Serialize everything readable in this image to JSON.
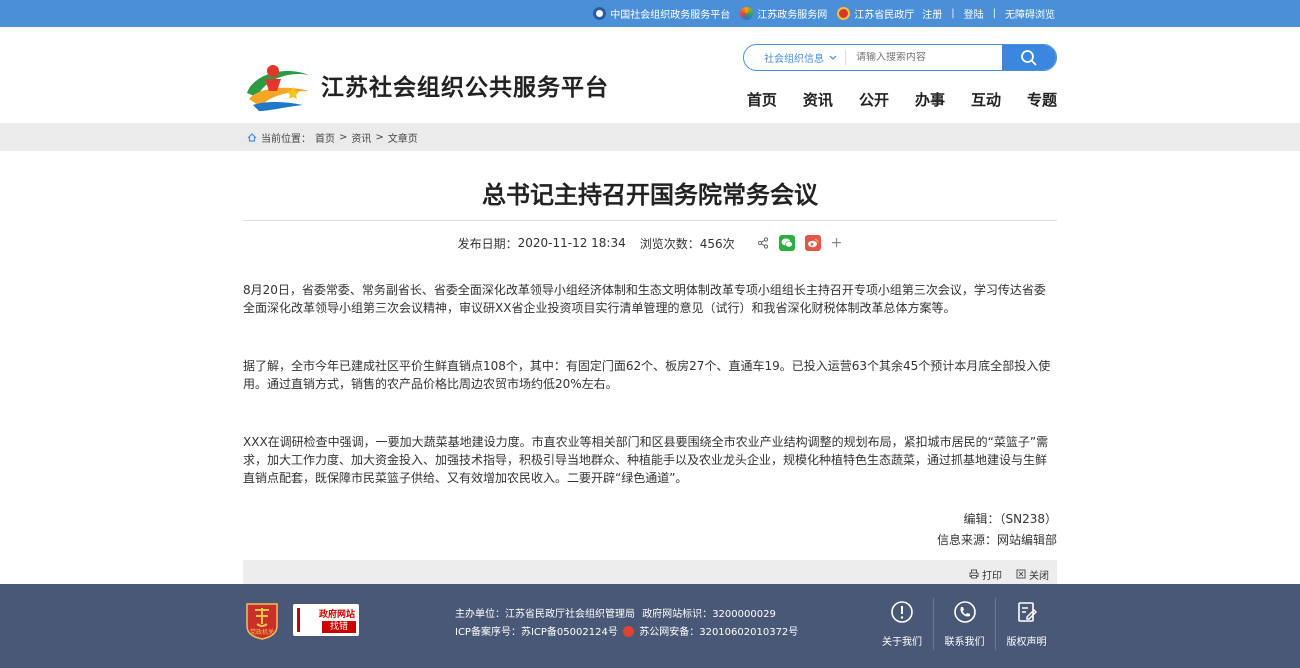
{
  "topbar": {
    "links": [
      {
        "label": "中国社会组织政务服务平台",
        "icon": "globe-icon"
      },
      {
        "label": "江苏政务服务网",
        "icon": "swirl-icon"
      },
      {
        "label": "江苏省民政厅",
        "icon": "emblem-icon"
      }
    ],
    "register": "注册",
    "login": "登陆",
    "accessible": "无障碍浏览"
  },
  "header": {
    "site_title": "江苏社会组织公共服务平台",
    "search_category": "社会组织信息",
    "search_placeholder": "请输入搜索内容",
    "nav": [
      "首页",
      "资讯",
      "公开",
      "办事",
      "互动",
      "专题"
    ]
  },
  "breadcrumb": {
    "prefix": "当前位置：",
    "items": [
      "首页",
      "资讯",
      "文章页"
    ],
    "separator": ">"
  },
  "article": {
    "title": "总书记主持召开国务院常务会议",
    "date_label": "发布日期：",
    "date": "2020-11-12 18:34",
    "views_label": "浏览次数：",
    "views": "456次",
    "paragraphs": [
      "8月20日，省委常委、常务副省长、省委全面深化改革领导小组经济体制和生态文明体制改革专项小组组长主持召开专项小组第三次会议，学习传达省委全面深化改革领导小组第三次会议精神，审议研XX省企业投资项目实行清单管理的意见（试行）和我省深化财税体制改革总体方案等。",
      "据了解，全市今年已建成社区平价生鲜直销点108个，其中：有固定门面62个、板房27个、直通车19。已投入运营63个其余45个预计本月底全部投入使用。通过直销方式，销售的农产品价格比周边农贸市场约低20%左右。",
      "XXX在调研检查中强调，一要加大蔬菜基地建设力度。市直农业等相关部门和区县要围绕全市农业产业结构调整的规划布局，紧扣城市居民的“菜篮子”需求，加大工作力度、加大资金投入、加强技术指导，积极引导当地群众、种植能手以及农业龙头企业，规模化种植特色生态蔬菜，通过抓基地建设与生鲜直销点配套，既保障市民菜篮子供给、又有效增加农民收入。二要开辟“绿色通道”。"
    ],
    "editor_label": "编辑：",
    "editor": "（SN238）",
    "source_label": "信息来源：",
    "source": "网站编辑部",
    "print": "打印",
    "close": "关闭"
  },
  "footer": {
    "logo1_text": "党政机关",
    "logo2_line1": "政府网站",
    "logo2_line2": "找错",
    "host_label": "主办单位：",
    "host": "江苏省民政厅社会组织管理局",
    "site_id_label": "政府网站标识：",
    "site_id": "3200000029",
    "icp_label": "ICP备案序号：",
    "icp": "苏ICP备05002124号",
    "police_label": "苏公网安备：",
    "police": "32010602010372号",
    "links": [
      "关于我们",
      "联系我们",
      "版权声明"
    ]
  },
  "colors": {
    "brand_blue": "#4b8fd8",
    "footer_bg": "#4a5877",
    "wechat_green": "#2aae3e",
    "weibo_red": "#e6544a"
  }
}
